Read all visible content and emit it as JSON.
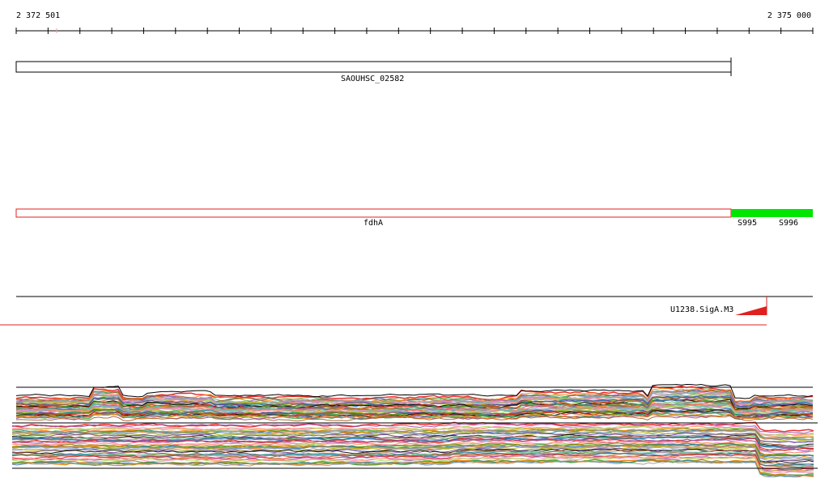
{
  "ruler": {
    "start_label": "2 372 501",
    "end_label": "2 375 000",
    "tick_count": 26
  },
  "tracks": {
    "locus": {
      "label": "SAOUHSC_02582",
      "color": "#000000"
    },
    "gene": {
      "label": "fdhA",
      "color": "#e0201e"
    },
    "segments": [
      {
        "label": "S995",
        "color": "#00e600"
      },
      {
        "label": "S996",
        "color": "#00e600"
      }
    ],
    "motif": {
      "label": "U1238.SigA.M3",
      "color": "#e0201e"
    }
  },
  "expression": {
    "palette": [
      "#e41a1c",
      "#377eb8",
      "#4daf4a",
      "#984ea3",
      "#ff7f00",
      "#a65628",
      "#f781bf",
      "#999999",
      "#66c2a5",
      "#fc8d62",
      "#8da0cb",
      "#e78ac3",
      "#a6d854",
      "#b3b300",
      "#1f78b4",
      "#33a02c",
      "#6a3d9a",
      "#b15928",
      "#808000",
      "#000000"
    ]
  }
}
